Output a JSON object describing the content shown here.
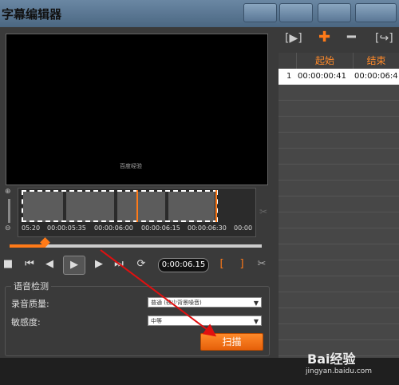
{
  "window": {
    "title": "字幕编辑器"
  },
  "preview": {
    "watermark": "百度经验"
  },
  "timeline": {
    "labels": [
      "05:20",
      "00:00:05:35",
      "00:00:06:00",
      "00:00:06:15",
      "00:00:06:30",
      "00:00"
    ]
  },
  "controls": {
    "timecode": "0:00:06.15",
    "bracket_in": "[",
    "bracket_out": "]"
  },
  "voice": {
    "legend": "语音检测",
    "quality_label": "录音质量:",
    "quality_value": "普通 (较少背景噪音)",
    "sensitivity_label": "敏感度:",
    "sensitivity_value": "中等",
    "scan_button": "扫描"
  },
  "subtitle_table": {
    "columns": [
      "起始",
      "结束"
    ],
    "rows": [
      {
        "index": "1",
        "start": "00:00:00:41",
        "end": "00:00:06:4"
      }
    ]
  },
  "watermark": {
    "brand": "Bai经验",
    "url": "jingyan.baidu.com"
  },
  "colors": {
    "accent": "#ff7a18",
    "annotation_arrow": "#e01010"
  }
}
